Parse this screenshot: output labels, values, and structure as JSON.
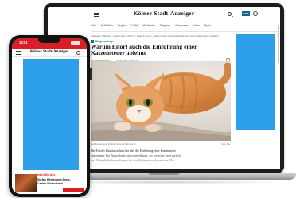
{
  "laptop": {
    "site": {
      "logo": "Kölner Stadt-Anzeiger",
      "nav": [
        "Köln",
        "A-10 Köln",
        "Region",
        "Politik",
        "Wirtschaft",
        "Ratgeber",
        "Panorama",
        "Kultur",
        "Sport"
      ],
      "breadcrumb": "Startseite > Region > Rhein-Sieg & Bonn > Stadt & Kreis > Warum Eitorf auch die Einführung einer Katzensteuer ablehnt",
      "tag": "Bürgerumfrage",
      "headline": "Warum Eitorf auch die Einführung einer Katzensteuer ablehnt",
      "byline_author": "Von Claudia Kerling",
      "byline_date": "08.11.2023, 16:00 Uhr",
      "caption": "Eine Katzensteuer für Eitorf lehnt die Mehrheit ab.",
      "caption_credit": "Foto: dpa",
      "teaser_lines": [
        "Der Eitorfer Hauptausschuss hat über die Einführung einer Katzensteuer",
        "abgestimmt. Ein Bürger hatte das vorgeschlagen – er fordert es nicht gerecht,",
        "dass Hundehalter keine Steuern für ihre Vierbeiner zahlen müssen. Die"
      ]
    },
    "ad_color": "#2d9ee8",
    "brand_color": "#0b6b8a"
  },
  "phone": {
    "time": "10:51",
    "logo": "Kölner Stadt-Anzeiger",
    "ad": {
      "title": "Nach Dir Ass",
      "line1": "Stefan Reiser und Anna-",
      "line2": "Carina Wottschack"
    },
    "statusbar_color": "#d81f26",
    "ad_color": "#2d9ee8"
  }
}
